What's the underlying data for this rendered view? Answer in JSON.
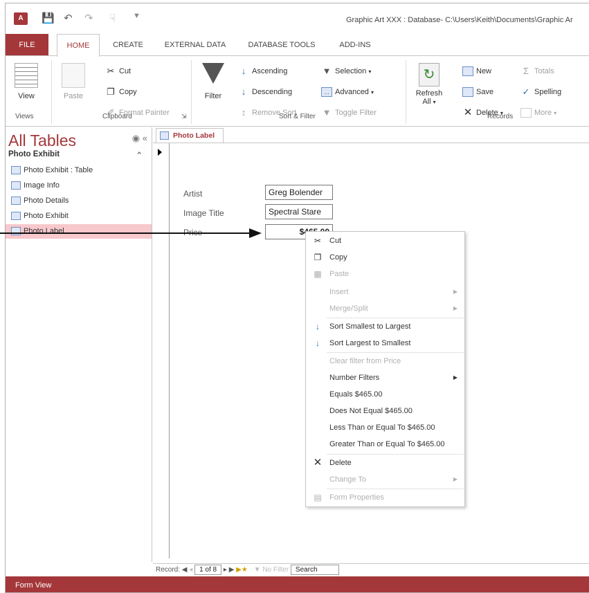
{
  "app": {
    "icon_letter": "A",
    "window_title": "Graphic Art XXX : Database- C:\\Users\\Keith\\Documents\\Graphic Ar"
  },
  "ribbon_tabs": [
    "FILE",
    "HOME",
    "CREATE",
    "EXTERNAL DATA",
    "DATABASE TOOLS",
    "ADD-INS"
  ],
  "groups": {
    "views": {
      "label": "Views",
      "view": "View"
    },
    "clipboard": {
      "label": "Clipboard",
      "paste": "Paste",
      "cut": "Cut",
      "copy": "Copy",
      "format_painter": "Format Painter"
    },
    "sort_filter": {
      "label": "Sort & Filter",
      "filter": "Filter",
      "ascending": "Ascending",
      "descending": "Descending",
      "remove_sort": "Remove Sort",
      "selection": "Selection",
      "advanced": "Advanced",
      "toggle_filter": "Toggle Filter"
    },
    "records": {
      "label": "Records",
      "refresh": "Refresh",
      "refresh_sub": "All",
      "new": "New",
      "save": "Save",
      "delete": "Delete",
      "totals": "Totals",
      "spelling": "Spelling",
      "more": "More"
    }
  },
  "nav": {
    "title": "All Tables",
    "group": "Photo Exhibit",
    "items": [
      {
        "label": "Photo Exhibit : Table"
      },
      {
        "label": "Image Info"
      },
      {
        "label": "Photo Details"
      },
      {
        "label": "Photo Exhibit"
      },
      {
        "label": "Photo Label",
        "selected": true
      }
    ]
  },
  "document_tab": "Photo Label",
  "form": {
    "fields": [
      {
        "label": "Artist",
        "value": "Greg Bolender"
      },
      {
        "label": "Image Title",
        "value": "Spectral Stare"
      },
      {
        "label": "Price",
        "value": "$465.00"
      }
    ]
  },
  "context_menu": [
    {
      "label": "Cut",
      "icon": "scissors-icon",
      "enabled": true
    },
    {
      "label": "Copy",
      "icon": "copy-icon",
      "enabled": true
    },
    {
      "label": "Paste",
      "icon": "paste-icon",
      "enabled": false
    },
    {
      "label": "Insert",
      "enabled": false,
      "submenu": true
    },
    {
      "label": "Merge/Split",
      "enabled": false,
      "submenu": true
    },
    {
      "label": "Sort Smallest to Largest",
      "icon": "sort-ascending-icon",
      "enabled": true
    },
    {
      "label": "Sort Largest to Smallest",
      "icon": "sort-descending-icon",
      "enabled": true
    },
    {
      "label": "Clear filter from Price",
      "enabled": false
    },
    {
      "label": "Number Filters",
      "enabled": true,
      "submenu": true
    },
    {
      "label": "Equals $465.00",
      "enabled": true
    },
    {
      "label": "Does Not Equal $465.00",
      "enabled": true
    },
    {
      "label": "Less Than or Equal To $465.00",
      "enabled": true
    },
    {
      "label": "Greater Than or Equal To $465.00",
      "enabled": true
    },
    {
      "label": "Delete",
      "icon": "delete-x-icon",
      "enabled": true
    },
    {
      "label": "Change To",
      "enabled": false,
      "submenu": true
    },
    {
      "label": "Form Properties",
      "icon": "properties-icon",
      "enabled": false
    }
  ],
  "record_nav": {
    "prefix": "Record:",
    "current": "1 of 8",
    "no_filter": "No Filter",
    "search": "Search"
  },
  "status_bar": "Form View",
  "colors": {
    "accent": "#a4373a",
    "selected_nav": "#f7c8cc"
  }
}
